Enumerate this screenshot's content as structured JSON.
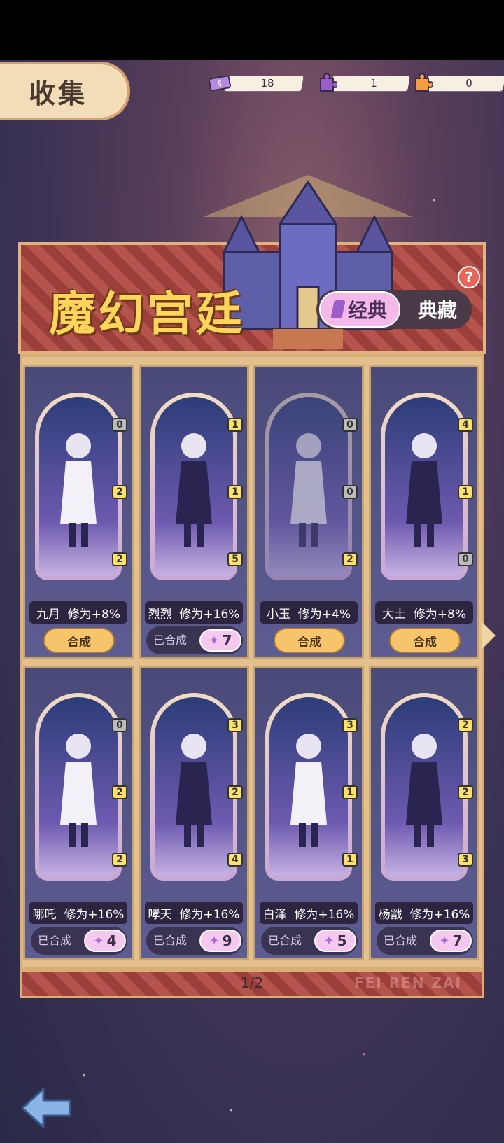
{
  "header": {
    "title": "收集"
  },
  "resources": [
    {
      "icon": "ticket-icon",
      "value": "18"
    },
    {
      "icon": "purple-puzzle-icon",
      "value": "1"
    },
    {
      "icon": "orange-puzzle-icon",
      "value": "0"
    }
  ],
  "banner": {
    "title": "魔幻宫廷",
    "tab_active": "经典",
    "tab_inactive": "典藏",
    "help": "?"
  },
  "cards": [
    {
      "name": "九月",
      "bonus": "修为+8%",
      "frags": [
        "0",
        "2",
        "2"
      ],
      "frag_colors": [
        "g",
        "y",
        "y"
      ],
      "state": "button",
      "button": "合成",
      "faded": false
    },
    {
      "name": "烈烈",
      "bonus": "修为+16%",
      "frags": [
        "1",
        "1",
        "5"
      ],
      "frag_colors": [
        "y",
        "y",
        "y"
      ],
      "state": "done",
      "done_label": "已合成",
      "count": "7",
      "faded": false
    },
    {
      "name": "小玉",
      "bonus": "修为+4%",
      "frags": [
        "0",
        "0",
        "2"
      ],
      "frag_colors": [
        "g",
        "g",
        "y"
      ],
      "state": "button",
      "button": "合成",
      "faded": true
    },
    {
      "name": "大士",
      "bonus": "修为+8%",
      "frags": [
        "4",
        "1",
        "0"
      ],
      "frag_colors": [
        "y",
        "y",
        "g"
      ],
      "state": "button",
      "button": "合成",
      "faded": false
    },
    {
      "name": "哪吒",
      "bonus": "修为+16%",
      "frags": [
        "0",
        "2",
        "2"
      ],
      "frag_colors": [
        "g",
        "y",
        "y"
      ],
      "state": "done",
      "done_label": "已合成",
      "count": "4",
      "faded": false
    },
    {
      "name": "哮天",
      "bonus": "修为+16%",
      "frags": [
        "3",
        "2",
        "4"
      ],
      "frag_colors": [
        "y",
        "y",
        "y"
      ],
      "state": "done",
      "done_label": "已合成",
      "count": "9",
      "faded": false
    },
    {
      "name": "白泽",
      "bonus": "修为+16%",
      "frags": [
        "3",
        "1",
        "1"
      ],
      "frag_colors": [
        "y",
        "y",
        "y"
      ],
      "state": "done",
      "done_label": "已合成",
      "count": "5",
      "faded": false
    },
    {
      "name": "杨戬",
      "bonus": "修为+16%",
      "frags": [
        "2",
        "2",
        "3"
      ],
      "frag_colors": [
        "y",
        "y",
        "y"
      ],
      "state": "done",
      "done_label": "已合成",
      "count": "7",
      "faded": false
    }
  ],
  "footer": {
    "page": "1/2",
    "watermark": "FEI REN ZAI"
  },
  "colors": {
    "accent": "#ffd45a",
    "button": "#f6c46a",
    "panel": "#e3c08e"
  }
}
